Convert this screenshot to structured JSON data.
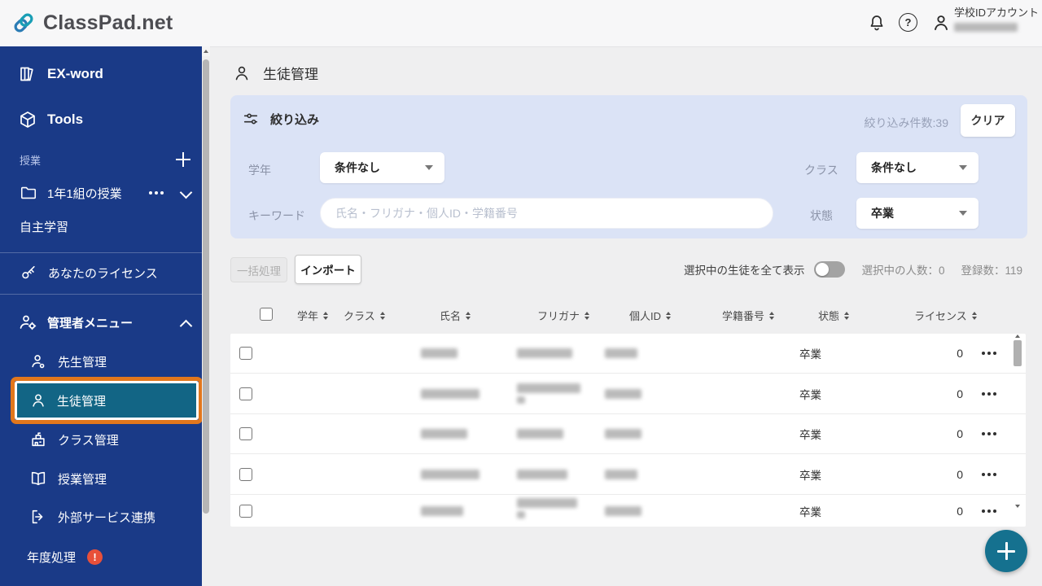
{
  "header": {
    "app_name": "ClassPad.net",
    "account_type_label": "学校IDアカウント",
    "help_glyph": "?"
  },
  "icons": {
    "logo": "chain-link",
    "notifications": "bell",
    "help": "question-circle",
    "account": "person",
    "filter": "sliders",
    "page": "person"
  },
  "colors": {
    "sidebar_blue": "#1a3a87",
    "selected_teal": "#126585",
    "highlight_orange": "#e2771c",
    "fab_teal": "#15718f",
    "alert_red": "#e8503a",
    "filter_panel": "#dbe3f6"
  },
  "sidebar": {
    "ex_word": "EX-word",
    "tools": "Tools",
    "lessons_section": "授業",
    "lesson_item": "1年1組の授業",
    "self_study": "自主学習",
    "your_license": "あなたのライセンス",
    "admin_menu": "管理者メニュー",
    "teacher_mgmt": "先生管理",
    "student_mgmt": "生徒管理",
    "class_mgmt": "クラス管理",
    "lesson_mgmt": "授業管理",
    "external_services": "外部サービス連携",
    "year_processing": "年度処理",
    "year_alert_glyph": "!"
  },
  "main": {
    "page_title": "生徒管理",
    "filter": {
      "title": "絞り込み",
      "count_text": "絞り込み件数:39",
      "clear_button": "クリア",
      "grade_label": "学年",
      "grade_value": "条件なし",
      "class_label": "クラス",
      "class_value": "条件なし",
      "keyword_label": "キーワード",
      "keyword_placeholder": "氏名・フリガナ・個人ID・学籍番号",
      "status_label": "状態",
      "status_value": "卒業"
    },
    "toolbar": {
      "bulk_button": "一括処理",
      "import_button": "インポート",
      "show_selected_label": "選択中の生徒を全て表示",
      "selected_count": "選択中の人数：0",
      "registered_count": "登録数：119"
    },
    "table": {
      "headers": [
        "学年",
        "クラス",
        "氏名",
        "フリガナ",
        "個人ID",
        "学籍番号",
        "状態",
        "ライセンス"
      ],
      "rows": [
        {
          "status": "卒業",
          "license": "0"
        },
        {
          "status": "卒業",
          "license": "0"
        },
        {
          "status": "卒業",
          "license": "0"
        },
        {
          "status": "卒業",
          "license": "0"
        },
        {
          "status": "卒業",
          "license": "0"
        }
      ]
    }
  }
}
